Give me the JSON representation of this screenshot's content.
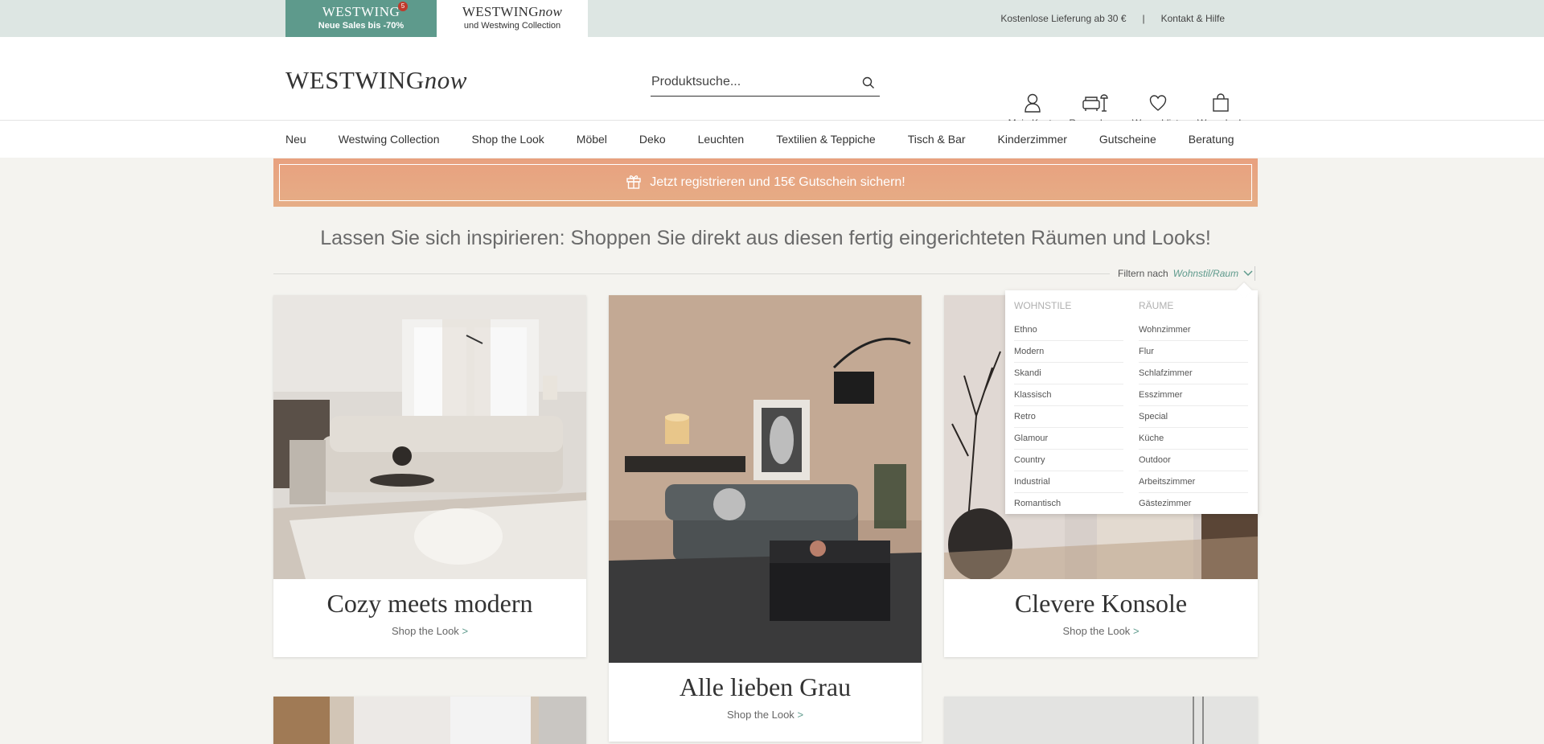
{
  "topbar": {
    "tab_westwing": {
      "logo": "WESTWING",
      "badge": "5",
      "sub": "Neue Sales bis -70%"
    },
    "tab_now": {
      "logo_main": "WESTWING",
      "logo_italic": "now",
      "sub": "und Westwing Collection"
    },
    "delivery": "Kostenlose Lieferung ab 30 €",
    "separator": "|",
    "contact": "Kontakt & Hilfe"
  },
  "header": {
    "logo_main": "WESTWING",
    "logo_italic": "now",
    "search": {
      "placeholder": "Produktsuche...",
      "value": ""
    },
    "icons": [
      {
        "label": "Mein Konto",
        "icon": "user-icon"
      },
      {
        "label": "Raumplaner",
        "icon": "room-planner-icon"
      },
      {
        "label": "Wunschliste",
        "icon": "heart-icon"
      },
      {
        "label": "Warenkorb",
        "icon": "bag-icon"
      }
    ]
  },
  "nav": {
    "items": [
      "Neu",
      "Westwing Collection",
      "Shop the Look",
      "Möbel",
      "Deko",
      "Leuchten",
      "Textilien & Teppiche",
      "Tisch & Bar",
      "Kinderzimmer",
      "Gutscheine",
      "Beratung"
    ]
  },
  "promo": {
    "text": "Jetzt registrieren und 15€ Gutschein sichern!"
  },
  "headline": "Lassen Sie sich inspirieren: Shoppen Sie direkt aus diesen fertig eingerichteten Räumen und Looks!",
  "filter": {
    "label": "Filtern nach",
    "value": "Wohnstil/Raum"
  },
  "dropdown": {
    "styles_head": "WOHNSTILE",
    "styles": [
      "Ethno",
      "Modern",
      "Skandi",
      "Klassisch",
      "Retro",
      "Glamour",
      "Country",
      "Industrial",
      "Romantisch"
    ],
    "rooms_head": "RÄUME",
    "rooms": [
      "Wohnzimmer",
      "Flur",
      "Schlafzimmer",
      "Esszimmer",
      "Special",
      "Küche",
      "Outdoor",
      "Arbeitszimmer",
      "Gästezimmer"
    ]
  },
  "cards": [
    {
      "title": "Cozy meets modern",
      "link": "Shop the Look",
      "arrow": ">"
    },
    {
      "title": "Alle lieben Grau",
      "link": "Shop the Look",
      "arrow": ">"
    },
    {
      "title": "Clevere Konsole",
      "link": "Shop the Look",
      "arrow": ">"
    }
  ],
  "colors": {
    "accent": "#5e9a8c",
    "promo": "#e8a17f",
    "background": "#f4f3ef"
  }
}
